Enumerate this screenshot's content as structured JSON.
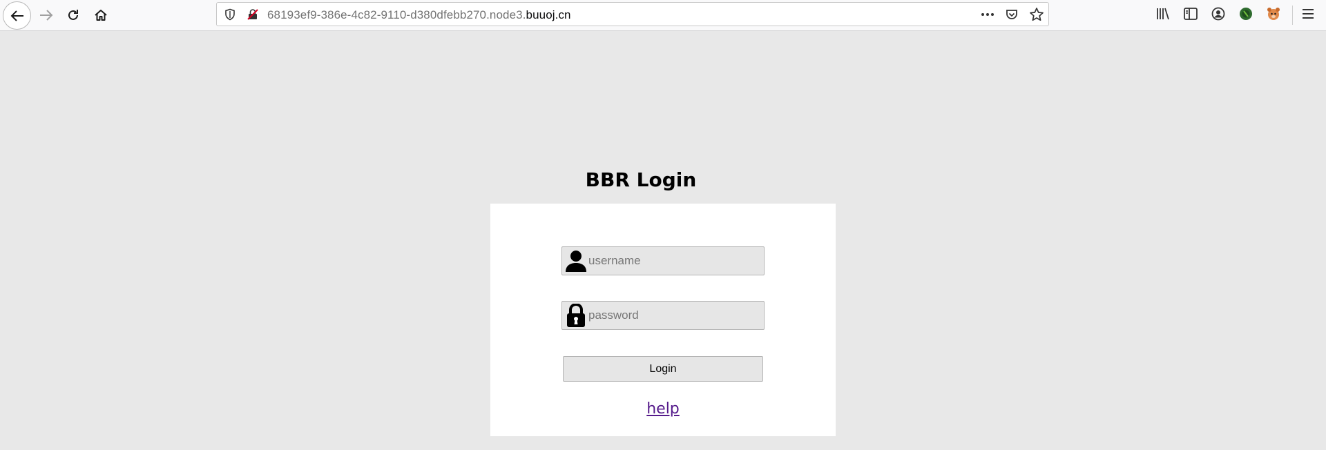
{
  "browser": {
    "url_prefix": "68193ef9-386e-4c82-9110-d380dfebb270.node3.",
    "url_host": "buuoj.cn",
    "icons": [
      "back-icon",
      "forward-icon",
      "reload-icon",
      "home-icon",
      "shield-icon",
      "insecure-lock-icon",
      "more-icon",
      "pocket-icon",
      "bookmark-star-icon",
      "library-icon",
      "sidebar-icon",
      "account-icon",
      "extension-icon",
      "extension-icon",
      "hamburger-menu-icon"
    ]
  },
  "page": {
    "title": "BBR Login",
    "username_placeholder": "username",
    "password_placeholder": "password",
    "login_label": "Login",
    "help_label": "help"
  },
  "colors": {
    "page_bg": "#e8e8e8",
    "link": "#551a8b",
    "field_bg": "#e6e6e6"
  }
}
